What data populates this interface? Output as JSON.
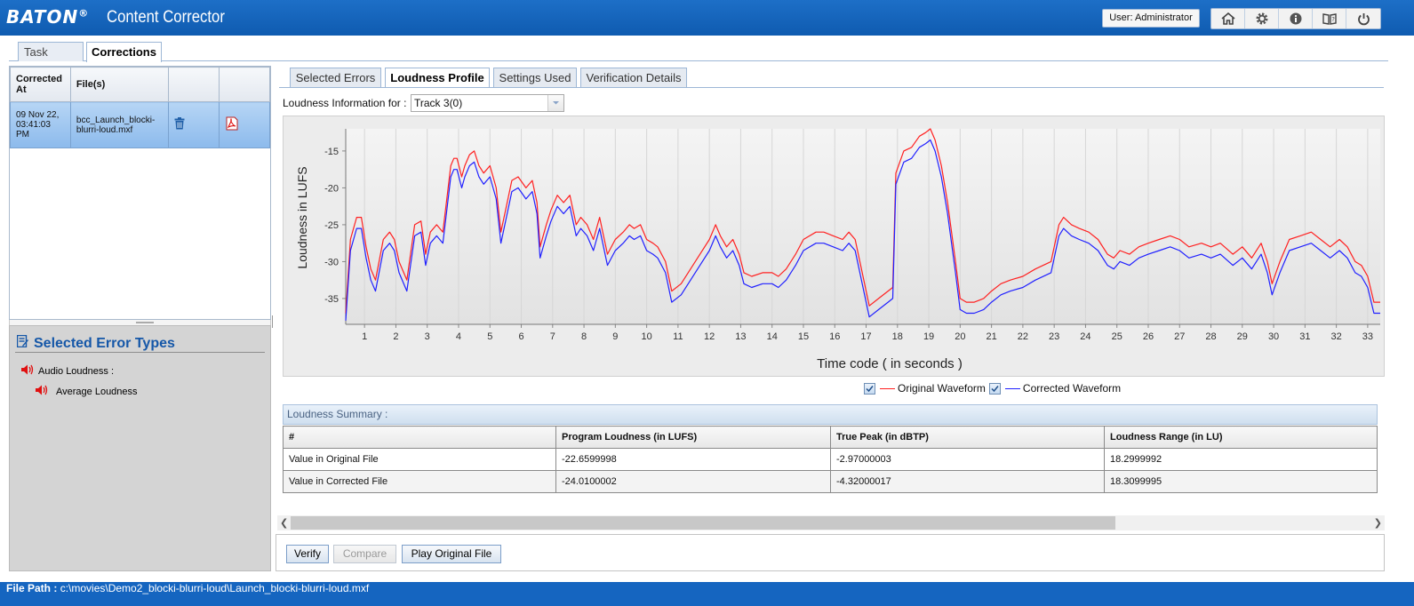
{
  "header": {
    "brand": "BATON",
    "brand_mark": "®",
    "app_title": "Content Corrector",
    "user_label": "User: Administrator",
    "icons": [
      "home-icon",
      "settings-gear-icon",
      "info-icon",
      "help-book-icon",
      "power-icon"
    ]
  },
  "top_tabs": [
    {
      "label": "Task",
      "active": false
    },
    {
      "label": "Corrections",
      "active": true
    }
  ],
  "corrections_table": {
    "headers": [
      "Corrected At",
      "File(s)",
      "",
      ""
    ],
    "rows": [
      {
        "corrected_at": "09 Nov 22, 03:41:03 PM",
        "file": "bcc_Launch_blocki-blurri-loud.mxf",
        "delete_icon": "trash-icon",
        "report_icon": "pdf-icon"
      }
    ]
  },
  "error_types": {
    "title": "Selected Error Types",
    "category": "Audio Loudness :",
    "item": "Average Loudness"
  },
  "sub_tabs": [
    {
      "label": "Selected Errors",
      "active": false
    },
    {
      "label": "Loudness Profile",
      "active": true
    },
    {
      "label": "Settings Used",
      "active": false
    },
    {
      "label": "Verification Details",
      "active": false
    }
  ],
  "loudness_info": {
    "label": "Loudness Information for :",
    "selected_track": "Track 3(0)"
  },
  "chart_data": {
    "type": "line",
    "title": "",
    "xlabel": "Time code ( in seconds )",
    "ylabel": "Loudness in LUFS",
    "xlim": [
      0.4,
      33.4
    ],
    "ylim": [
      -38.5,
      -12
    ],
    "x_ticks": [
      1,
      2,
      3,
      4,
      5,
      6,
      7,
      8,
      9,
      10,
      11,
      12,
      13,
      14,
      15,
      16,
      17,
      18,
      19,
      20,
      21,
      22,
      23,
      24,
      25,
      26,
      27,
      28,
      29,
      30,
      31,
      32,
      33
    ],
    "y_ticks": [
      -35,
      -30,
      -25,
      -20,
      -15
    ],
    "grid": true,
    "colors": {
      "original": "#ff2020",
      "corrected": "#2020ff"
    },
    "series": [
      {
        "name": "Original Waveform",
        "x": [
          0.4,
          0.55,
          0.75,
          0.9,
          1.05,
          1.2,
          1.35,
          1.6,
          1.8,
          1.95,
          2.1,
          2.35,
          2.6,
          2.8,
          2.95,
          3.1,
          3.3,
          3.5,
          3.75,
          3.85,
          3.95,
          4.1,
          4.2,
          4.35,
          4.5,
          4.65,
          4.8,
          5.0,
          5.2,
          5.35,
          5.5,
          5.7,
          5.9,
          6.15,
          6.35,
          6.5,
          6.6,
          6.8,
          6.95,
          7.15,
          7.35,
          7.55,
          7.75,
          7.9,
          8.1,
          8.3,
          8.5,
          8.6,
          8.75,
          9.0,
          9.25,
          9.45,
          9.6,
          9.8,
          10.0,
          10.2,
          10.35,
          10.6,
          10.8,
          11.1,
          11.4,
          11.7,
          12.0,
          12.2,
          12.35,
          12.55,
          12.75,
          12.95,
          13.1,
          13.35,
          13.7,
          14.0,
          14.2,
          14.45,
          14.75,
          15.0,
          15.4,
          15.65,
          15.95,
          16.25,
          16.45,
          16.65,
          16.8,
          17.1,
          17.4,
          17.7,
          17.85,
          17.95,
          18.2,
          18.45,
          18.7,
          18.9,
          19.05,
          19.2,
          19.4,
          19.6,
          19.85,
          20.0,
          20.2,
          20.45,
          20.75,
          21.0,
          21.3,
          21.6,
          22.0,
          22.4,
          22.9,
          23.0,
          23.15,
          23.3,
          23.55,
          23.8,
          24.1,
          24.4,
          24.7,
          24.9,
          25.1,
          25.4,
          25.7,
          26.0,
          26.35,
          26.7,
          27.0,
          27.3,
          27.7,
          28.0,
          28.3,
          28.7,
          29.0,
          29.3,
          29.6,
          29.8,
          29.95,
          30.2,
          30.5,
          30.85,
          31.2,
          31.5,
          31.8,
          32.1,
          32.35,
          32.6,
          32.8,
          33.0,
          33.2,
          33.4
        ],
        "y": [
          -37,
          -27,
          -24,
          -24,
          -28,
          -31,
          -32.5,
          -27,
          -26,
          -27,
          -30,
          -32.5,
          -25,
          -24.5,
          -29,
          -26,
          -25,
          -26,
          -17,
          -16,
          -16,
          -18.5,
          -17,
          -15.5,
          -15,
          -17,
          -18,
          -17,
          -20,
          -26,
          -23,
          -19,
          -18.5,
          -20,
          -19,
          -22,
          -28,
          -25,
          -23,
          -21,
          -22,
          -21,
          -25,
          -24,
          -25,
          -27,
          -24,
          -26,
          -29,
          -27,
          -26,
          -25,
          -25.5,
          -25,
          -27,
          -27.5,
          -28,
          -30,
          -34,
          -33,
          -31,
          -29,
          -27,
          -25,
          -26.5,
          -28,
          -27,
          -29,
          -31.5,
          -32,
          -31.5,
          -31.5,
          -32,
          -31,
          -29,
          -27,
          -26,
          -26,
          -26.5,
          -27,
          -26,
          -27,
          -30,
          -36,
          -35,
          -34,
          -33.5,
          -18,
          -15,
          -14.5,
          -13,
          -12.5,
          -12,
          -13.5,
          -17,
          -22,
          -30,
          -35,
          -35.5,
          -35.5,
          -35,
          -34,
          -33,
          -32.5,
          -32,
          -31,
          -30,
          -28,
          -25,
          -24,
          -25,
          -25.5,
          -26,
          -27,
          -29,
          -29.5,
          -28.5,
          -29,
          -28,
          -27.5,
          -27,
          -26.5,
          -27,
          -28,
          -27.5,
          -28,
          -27.5,
          -29,
          -28,
          -29.5,
          -27.5,
          -30,
          -33,
          -30,
          -27,
          -26.5,
          -26,
          -27,
          -28,
          -27,
          -28,
          -30,
          -30.5,
          -32,
          -35.5,
          -35.5
        ]
      },
      {
        "name": "Corrected Waveform",
        "x": [
          0.4,
          0.55,
          0.75,
          0.9,
          1.05,
          1.2,
          1.35,
          1.6,
          1.8,
          1.95,
          2.1,
          2.35,
          2.6,
          2.8,
          2.95,
          3.1,
          3.3,
          3.5,
          3.75,
          3.85,
          3.95,
          4.1,
          4.2,
          4.35,
          4.5,
          4.65,
          4.8,
          5.0,
          5.2,
          5.35,
          5.5,
          5.7,
          5.9,
          6.15,
          6.35,
          6.5,
          6.6,
          6.8,
          6.95,
          7.15,
          7.35,
          7.55,
          7.75,
          7.9,
          8.1,
          8.3,
          8.5,
          8.6,
          8.75,
          9.0,
          9.25,
          9.45,
          9.6,
          9.8,
          10.0,
          10.2,
          10.35,
          10.6,
          10.8,
          11.1,
          11.4,
          11.7,
          12.0,
          12.2,
          12.35,
          12.55,
          12.75,
          12.95,
          13.1,
          13.35,
          13.7,
          14.0,
          14.2,
          14.45,
          14.75,
          15.0,
          15.4,
          15.65,
          15.95,
          16.25,
          16.45,
          16.65,
          16.8,
          17.1,
          17.4,
          17.7,
          17.85,
          17.95,
          18.2,
          18.45,
          18.7,
          18.9,
          19.05,
          19.2,
          19.4,
          19.6,
          19.85,
          20.0,
          20.2,
          20.45,
          20.75,
          21.0,
          21.3,
          21.6,
          22.0,
          22.4,
          22.9,
          23.0,
          23.15,
          23.3,
          23.55,
          23.8,
          24.1,
          24.4,
          24.7,
          24.9,
          25.1,
          25.4,
          25.7,
          26.0,
          26.35,
          26.7,
          27.0,
          27.3,
          27.7,
          28.0,
          28.3,
          28.7,
          29.0,
          29.3,
          29.6,
          29.8,
          29.95,
          30.2,
          30.5,
          30.85,
          31.2,
          31.5,
          31.8,
          32.1,
          32.35,
          32.6,
          32.8,
          33.0,
          33.2,
          33.4
        ],
        "y": [
          -38,
          -28.5,
          -25.5,
          -25.5,
          -29.5,
          -32.5,
          -34,
          -28.5,
          -27.5,
          -28.5,
          -31.5,
          -34,
          -26.5,
          -26,
          -30.5,
          -27.5,
          -26.5,
          -27.5,
          -18.5,
          -17.5,
          -17.5,
          -20,
          -18.5,
          -17,
          -16.5,
          -18.5,
          -19.5,
          -18.5,
          -21.5,
          -27.5,
          -24.5,
          -20.5,
          -20,
          -21.5,
          -20.5,
          -23.5,
          -29.5,
          -26.5,
          -24.5,
          -22.5,
          -23.5,
          -22.5,
          -26.5,
          -25.5,
          -26.5,
          -28.5,
          -25.5,
          -27.5,
          -30.5,
          -28.5,
          -27.5,
          -26.5,
          -27,
          -26.5,
          -28.5,
          -29,
          -29.5,
          -31.5,
          -35.5,
          -34.5,
          -32.5,
          -30.5,
          -28.5,
          -26.5,
          -28,
          -29.5,
          -28.5,
          -30.5,
          -33,
          -33.5,
          -33,
          -33,
          -33.5,
          -32.5,
          -30.5,
          -28.5,
          -27.5,
          -27.5,
          -28,
          -28.5,
          -27.5,
          -28.5,
          -31.5,
          -37.5,
          -36.5,
          -35.5,
          -35,
          -19.5,
          -16.5,
          -16,
          -14.5,
          -14,
          -13.5,
          -15,
          -18.5,
          -23.5,
          -31.5,
          -36.5,
          -37,
          -37,
          -36.5,
          -35.5,
          -34.5,
          -34,
          -33.5,
          -32.5,
          -31.5,
          -29.5,
          -26.5,
          -25.5,
          -26.5,
          -27,
          -27.5,
          -28.5,
          -30.5,
          -31,
          -30,
          -30.5,
          -29.5,
          -29,
          -28.5,
          -28,
          -28.5,
          -29.5,
          -29,
          -29.5,
          -29,
          -30.5,
          -29.5,
          -31,
          -29,
          -31.5,
          -34.5,
          -31.5,
          -28.5,
          -28,
          -27.5,
          -28.5,
          -29.5,
          -28.5,
          -29.5,
          -31.5,
          -32,
          -33.5,
          -37,
          -37
        ]
      }
    ]
  },
  "legend": {
    "original": "Original Waveform",
    "corrected": "Corrected Waveform"
  },
  "summary": {
    "title": "Loudness Summary :",
    "headers": [
      "#",
      "Program Loudness (in LUFS)",
      "True Peak (in dBTP)",
      "Loudness Range (in LU)"
    ],
    "rows": [
      [
        "Value in Original File",
        "-22.6599998",
        "-2.97000003",
        "18.2999992"
      ],
      [
        "Value in Corrected File",
        "-24.0100002",
        "-4.32000017",
        "18.3099995"
      ]
    ]
  },
  "buttons": {
    "verify": "Verify",
    "compare": "Compare",
    "play_original": "Play Original File"
  },
  "status": {
    "label": "File Path :",
    "path": "c:\\movies\\Demo2_blocki-blurri-loud\\Launch_blocki-blurri-loud.mxf"
  }
}
